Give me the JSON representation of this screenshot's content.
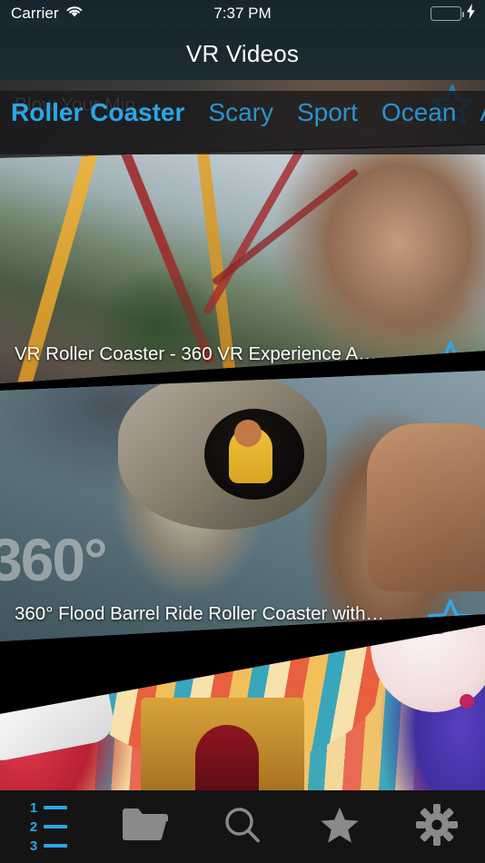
{
  "status_bar": {
    "carrier": "Carrier",
    "wifi_icon": "wifi-icon",
    "time": "7:37 PM",
    "battery_icon": "battery-icon",
    "charging_icon": "lightning-bolt-icon",
    "battery_color": "#3ddb5a"
  },
  "navbar": {
    "title": "VR Videos",
    "background": "#1a2830"
  },
  "tabs": {
    "accent_color": "#2aa6e8",
    "items": [
      {
        "label": "Roller Coaster",
        "active": true
      },
      {
        "label": "Scary",
        "active": false
      },
      {
        "label": "Sport",
        "active": false
      },
      {
        "label": "Ocean",
        "active": false
      },
      {
        "label": "A",
        "active": false
      }
    ]
  },
  "video_list": [
    {
      "title": "Blow Your Min…",
      "star_icon": "star-outline-icon",
      "starred": false,
      "partially_hidden": true
    },
    {
      "title": "VR Roller Coaster - 360 VR Experience A…",
      "star_icon": "star-outline-icon",
      "starred": false,
      "partially_hidden": false
    },
    {
      "title": "360° Flood Barrel Ride Roller Coaster with…",
      "star_icon": "star-outline-icon",
      "starred": false,
      "partially_hidden": false
    },
    {
      "title": "",
      "star_icon": "",
      "starred": false,
      "partially_hidden": true
    }
  ],
  "toolbar": {
    "items": [
      {
        "name": "playlist-button",
        "icon": "numbered-list-icon",
        "active": true
      },
      {
        "name": "folder-button",
        "icon": "folder-icon",
        "active": false
      },
      {
        "name": "search-button",
        "icon": "search-icon",
        "active": false
      },
      {
        "name": "favorites-button",
        "icon": "star-filled-icon",
        "active": false
      },
      {
        "name": "settings-button",
        "icon": "gear-icon",
        "active": false
      }
    ],
    "active_color": "#2aa6e8",
    "inactive_color": "#8a8a8a",
    "background": "#141414"
  }
}
